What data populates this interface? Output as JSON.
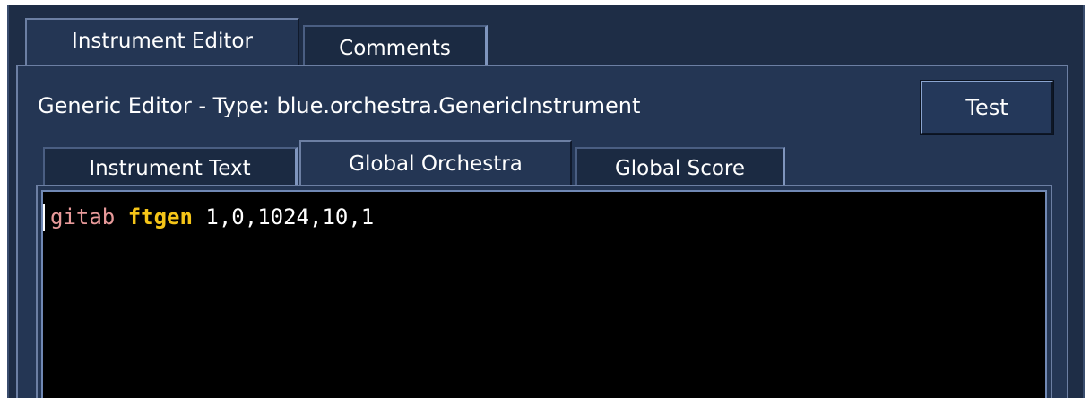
{
  "outer_tabs": [
    {
      "label": "Instrument Editor",
      "selected": true
    },
    {
      "label": "Comments",
      "selected": false
    }
  ],
  "editor_type_label": "Generic Editor - Type: blue.orchestra.GenericInstrument",
  "test_button_label": "Test",
  "inner_tabs": [
    {
      "label": "Instrument Text",
      "selected": false
    },
    {
      "label": "Global Orchestra",
      "selected": true
    },
    {
      "label": "Global Score",
      "selected": false
    }
  ],
  "code": {
    "variable": "gitab",
    "opcode": "ftgen",
    "arguments": "1,0,1024,10,1"
  },
  "colors": {
    "background": "#1e2d46",
    "panel": "#243654",
    "editor_background": "#000000",
    "variable_token": "#e89a9a",
    "opcode_token": "#f5c518",
    "argument_token": "#ffffff"
  }
}
